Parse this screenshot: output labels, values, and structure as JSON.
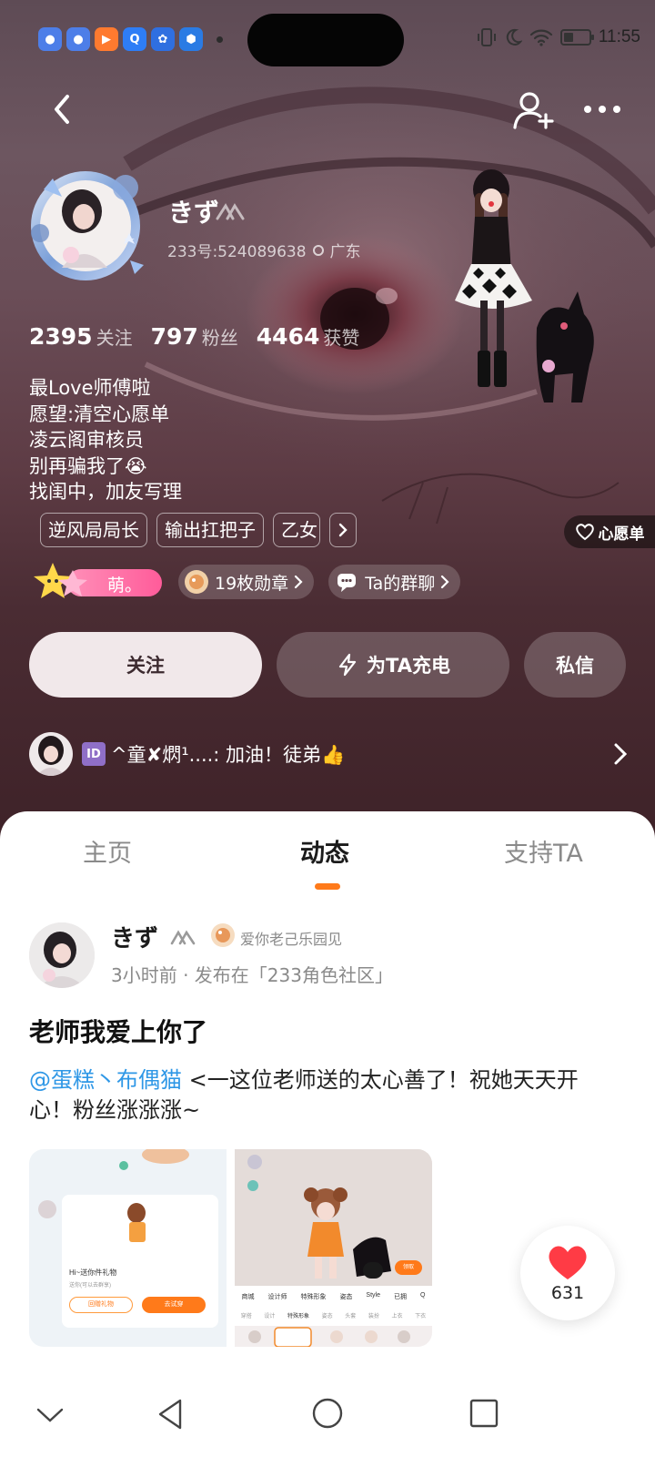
{
  "status_bar": {
    "time": "11:55",
    "app_icons": [
      "chat-app-icon",
      "chat-app-icon",
      "video-app-icon",
      "browser-app-icon",
      "baidu-app-icon",
      "security-app-icon"
    ]
  },
  "profile": {
    "nickname": "きず",
    "uid_text": "233号:524089638",
    "location": "广东",
    "stats": [
      {
        "value": "2395",
        "label": "关注"
      },
      {
        "value": "797",
        "label": "粉丝"
      },
      {
        "value": "4464",
        "label": "获赞"
      }
    ],
    "bio_lines": [
      "最Love师傅啦",
      "愿望:清空心愿单",
      "凌云阁审核员",
      "别再骗我了😭",
      "找闺中，加友写理"
    ],
    "tags": [
      "逆风局局长",
      "输出扛把子",
      "乙女"
    ],
    "wishlist_label": "心愿单",
    "mood_badge": "萌。",
    "medals_label": "19枚勋章",
    "group_chat_label": "Ta的群聊"
  },
  "actions": {
    "follow": "关注",
    "charge": "为TA充电",
    "message": "私信"
  },
  "message_preview": {
    "id_badge": "ID",
    "text": "^童✘熌¹....: 加油！徒弟👍"
  },
  "tabs": [
    {
      "label": "主页",
      "active": false
    },
    {
      "label": "动态",
      "active": true
    },
    {
      "label": "支持TA",
      "active": false
    }
  ],
  "post": {
    "author": "きず",
    "group_name": "爱你老己乐园见",
    "meta": "3小时前 · 发布在「233角色社区」",
    "title": "老师我爱上你了",
    "mention": "@蛋糕丶布偶猫",
    "body": " <一这位老师送的太心善了！祝她天天开心！粉丝涨涨涨~",
    "like_count": "631",
    "thumb1": {
      "heading": "Hi~送你件礼物",
      "subtext": "送你(可以去群享)",
      "btn_left": "回赠礼物",
      "btn_right": "去试穿"
    },
    "thumb2": {
      "menu": [
        "商城",
        "设计师",
        "特殊形象",
        "姿态",
        "Style",
        "已拥",
        "Q"
      ],
      "submenu": [
        "穿搭",
        "设计",
        "特殊形象",
        "姿态",
        "头套",
        "装扮",
        "上衣",
        "下衣"
      ],
      "tag": "领取"
    }
  },
  "colors": {
    "accent": "#ff7a1a",
    "mention": "#2e97e6",
    "pink": "#ff5c9a"
  }
}
